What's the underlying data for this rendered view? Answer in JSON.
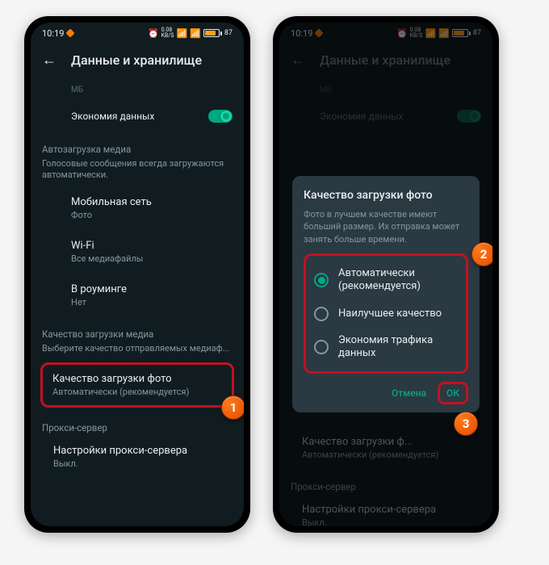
{
  "status": {
    "time": "10:19",
    "kbs": "0.08",
    "kbs_unit": "KB/S",
    "battery": "87"
  },
  "header": {
    "title": "Данные и хранилище"
  },
  "top_trunc": "МБ",
  "data_saver": {
    "label": "Экономия данных"
  },
  "auto_media": {
    "title": "Автозагрузка медиа",
    "desc": "Голосовые сообщения всегда загружаются автоматически."
  },
  "mobile": {
    "label": "Мобильная сеть",
    "sub": "Фото"
  },
  "wifi": {
    "label": "Wi-Fi",
    "sub": "Все медиафайлы"
  },
  "roaming": {
    "label": "В роуминге",
    "sub": "Нет"
  },
  "upload_q": {
    "title": "Качество загрузки медиа",
    "desc": "Выберите качество отправляемых медиаф..."
  },
  "photo_q": {
    "label": "Качество загрузки фото",
    "sub": "Автоматически (рекомендуется)"
  },
  "proxy": {
    "title": "Прокси-сервер",
    "label": "Настройки прокси-сервера",
    "sub": "Выкл."
  },
  "dialog": {
    "title": "Качество загрузки фото",
    "desc": "Фото в лучшем качестве имеют больший размер. Их отправка может занять больше времени.",
    "opt1": "Автоматически (рекомендуется)",
    "opt2": "Наилучшее качество",
    "opt3": "Экономия трафика данных",
    "cancel": "Отмена",
    "ok": "ОК"
  },
  "photo_q_trunc": "Качество загрузки ф...",
  "callouts": {
    "c1": "1",
    "c2": "2",
    "c3": "3"
  }
}
